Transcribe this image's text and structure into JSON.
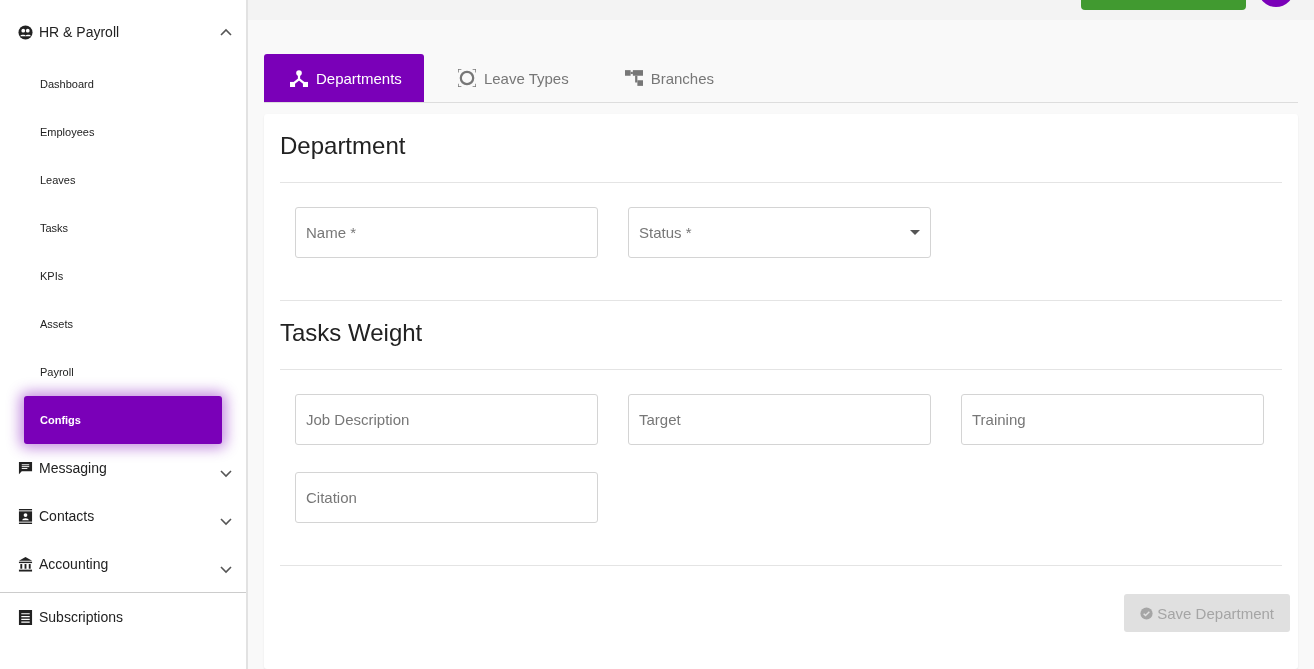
{
  "sidebar": {
    "items": [
      {
        "label": "HR & Payroll",
        "expanded": true,
        "children": [
          {
            "label": "Dashboard",
            "selected": false
          },
          {
            "label": "Employees",
            "selected": false
          },
          {
            "label": "Leaves",
            "selected": false
          },
          {
            "label": "Tasks",
            "selected": false
          },
          {
            "label": "KPIs",
            "selected": false
          },
          {
            "label": "Assets",
            "selected": false
          },
          {
            "label": "Payroll",
            "selected": false
          },
          {
            "label": "Configs",
            "selected": true
          }
        ]
      },
      {
        "label": "Messaging",
        "expanded": false
      },
      {
        "label": "Contacts",
        "expanded": false
      },
      {
        "label": "Accounting",
        "expanded": false
      }
    ],
    "footer_items": [
      {
        "label": "Subscriptions"
      }
    ]
  },
  "tabs": [
    {
      "label": "Departments",
      "selected": true
    },
    {
      "label": "Leave Types",
      "selected": false
    },
    {
      "label": "Branches",
      "selected": false
    }
  ],
  "sections": [
    {
      "title": "Department",
      "fields": [
        {
          "placeholder": "Name *",
          "kind": "text"
        },
        {
          "placeholder": "Status *",
          "kind": "select"
        }
      ]
    },
    {
      "title": "Tasks Weight",
      "fields": [
        {
          "placeholder": "Job Description",
          "kind": "text"
        },
        {
          "placeholder": "Target",
          "kind": "text"
        },
        {
          "placeholder": "Training",
          "kind": "text"
        },
        {
          "placeholder": "Citation",
          "kind": "text"
        }
      ]
    }
  ],
  "save_button": {
    "label": "Save Department",
    "disabled": true
  }
}
